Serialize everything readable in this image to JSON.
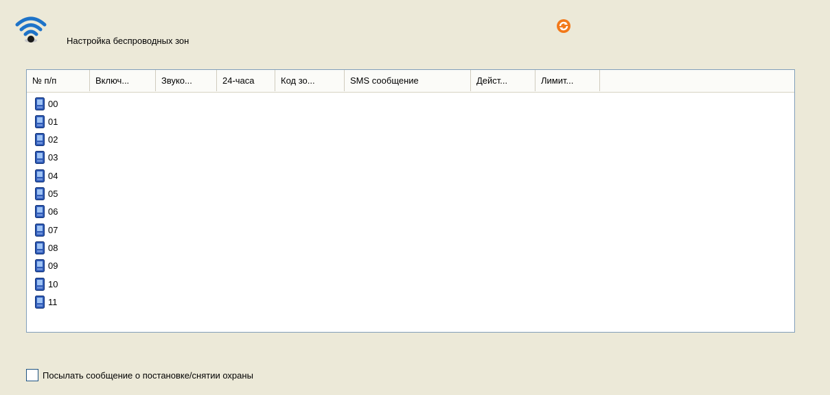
{
  "header": {
    "title": "Настройка беспроводных зон",
    "wifi_icon": "wireless-icon",
    "refresh_icon": "refresh-icon"
  },
  "table": {
    "columns": [
      "№ п/п",
      "Включ...",
      "Звуко...",
      "24-часа",
      "Код зо...",
      "SMS сообщение",
      "Дейст...",
      "Лимит..."
    ],
    "rows": [
      "00",
      "01",
      "02",
      "03",
      "04",
      "05",
      "06",
      "07",
      "08",
      "09",
      "10",
      "11"
    ],
    "row_icon": "zone-device-icon"
  },
  "options": {
    "send_message_label": "Посылать сообщение о постановке/снятии охраны",
    "send_message_checked": false
  },
  "colors": {
    "background": "#ece9d8",
    "list_border": "#7f9db9",
    "accent": "#1c5180",
    "refresh": "#f2791a"
  }
}
